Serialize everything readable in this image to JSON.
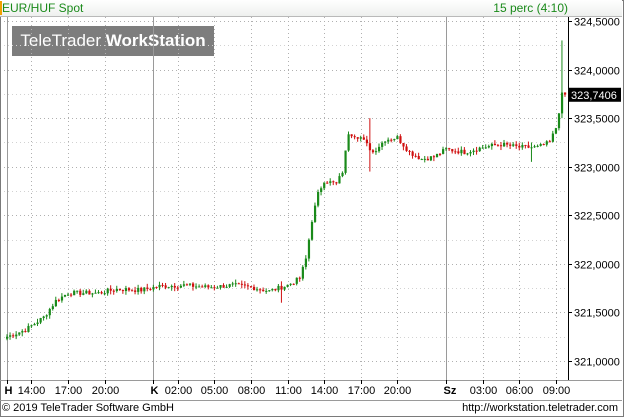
{
  "header": {
    "title": "EUR/HUF Spot",
    "period": "15 perc (4:10)"
  },
  "brand": {
    "part1": "TeleTrader",
    "part2": "WorkStation"
  },
  "footer": {
    "copyright": "© 2019 TeleTrader Software GmbH",
    "url": "http://workstation.teletrader.com"
  },
  "colors": {
    "up": "#1a8a1a",
    "down": "#d01010",
    "grid": "#b0b0b0",
    "accent": "#1a8a1a",
    "brand_bg": "#7d7d7d"
  },
  "chart_data": {
    "type": "candlestick",
    "title": "EUR/HUF Spot",
    "interval": "15 perc (4:10)",
    "ylim": [
      320.8,
      324.6
    ],
    "y_ticks": [
      "324,5000",
      "324,0000",
      "323,5000",
      "323,0000",
      "322,5000",
      "322,0000",
      "321,5000",
      "321,0000"
    ],
    "y_tick_values": [
      324.5,
      324.0,
      323.5,
      323.0,
      322.5,
      322.0,
      321.5,
      321.0
    ],
    "last_price_label": "323,7406",
    "last_price": 323.7406,
    "x_ticks": [
      {
        "label": "H",
        "bold": true,
        "idx": 0
      },
      {
        "label": "14:00",
        "bold": false,
        "idx": 8
      },
      {
        "label": "17:00",
        "bold": false,
        "idx": 20
      },
      {
        "label": "20:00",
        "bold": false,
        "idx": 32
      },
      {
        "label": "K",
        "bold": true,
        "idx": 48
      },
      {
        "label": "02:00",
        "bold": false,
        "idx": 56
      },
      {
        "label": "05:00",
        "bold": false,
        "idx": 68
      },
      {
        "label": "08:00",
        "bold": false,
        "idx": 80
      },
      {
        "label": "11:00",
        "bold": false,
        "idx": 92
      },
      {
        "label": "14:00",
        "bold": false,
        "idx": 104
      },
      {
        "label": "17:00",
        "bold": false,
        "idx": 116
      },
      {
        "label": "20:00",
        "bold": false,
        "idx": 128
      },
      {
        "label": "Sz",
        "bold": true,
        "idx": 144
      },
      {
        "label": "03:00",
        "bold": false,
        "idx": 156
      },
      {
        "label": "06:00",
        "bold": false,
        "idx": 168
      },
      {
        "label": "09:00",
        "bold": false,
        "idx": 180
      }
    ],
    "anchors": [
      [
        0,
        321.25
      ],
      [
        6,
        321.32
      ],
      [
        12,
        321.45
      ],
      [
        16,
        321.62
      ],
      [
        20,
        321.7
      ],
      [
        30,
        321.7
      ],
      [
        36,
        321.74
      ],
      [
        44,
        321.73
      ],
      [
        50,
        321.77
      ],
      [
        58,
        321.78
      ],
      [
        66,
        321.76
      ],
      [
        74,
        321.78
      ],
      [
        80,
        321.76
      ],
      [
        86,
        321.72
      ],
      [
        92,
        321.78
      ],
      [
        96,
        321.85
      ],
      [
        98,
        322.05
      ],
      [
        100,
        322.45
      ],
      [
        102,
        322.72
      ],
      [
        104,
        322.86
      ],
      [
        108,
        322.82
      ],
      [
        110,
        322.95
      ],
      [
        112,
        323.35
      ],
      [
        116,
        323.3
      ],
      [
        120,
        323.15
      ],
      [
        124,
        323.28
      ],
      [
        128,
        323.3
      ],
      [
        132,
        323.15
      ],
      [
        136,
        323.08
      ],
      [
        140,
        323.1
      ],
      [
        144,
        323.18
      ],
      [
        150,
        323.15
      ],
      [
        156,
        323.2
      ],
      [
        162,
        323.23
      ],
      [
        168,
        323.2
      ],
      [
        174,
        323.2
      ],
      [
        178,
        323.25
      ],
      [
        180,
        323.4
      ],
      [
        182,
        323.74
      ]
    ],
    "spikes": [
      [
        182,
        324.3,
        323.5
      ],
      [
        119,
        323.5,
        322.95
      ],
      [
        90,
        321.82,
        321.6
      ],
      [
        172,
        323.25,
        323.05
      ]
    ]
  }
}
